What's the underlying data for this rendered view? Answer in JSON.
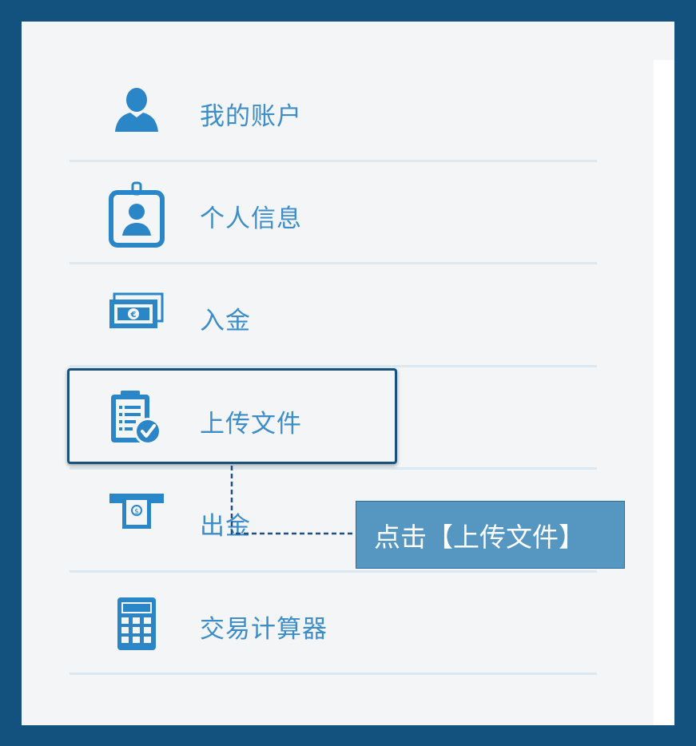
{
  "menu": {
    "items": [
      {
        "label": "我的账户",
        "icon": "user-icon"
      },
      {
        "label": "个人信息",
        "icon": "id-badge-icon"
      },
      {
        "label": "入金",
        "icon": "money-icon"
      },
      {
        "label": "上传文件",
        "icon": "clipboard-check-icon"
      },
      {
        "label": "出金",
        "icon": "atm-withdraw-icon"
      },
      {
        "label": "交易计算器",
        "icon": "calculator-icon"
      }
    ]
  },
  "callout": {
    "text": "点击【上传文件】"
  },
  "colors": {
    "frame": "#13527f",
    "accent": "#3c8dc8",
    "callout_bg": "#5697c1"
  }
}
